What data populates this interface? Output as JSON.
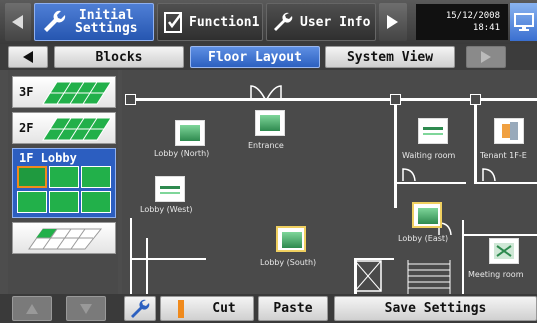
{
  "topbar": {
    "tabs": [
      {
        "label_line1": "Initial",
        "label_line2": "Settings",
        "icon": "wrench-icon"
      },
      {
        "label": "Function1",
        "icon": "checklist-icon"
      },
      {
        "label": "User Info",
        "icon": "wrench-icon"
      }
    ],
    "date": "15/12/2008",
    "time": "18:41"
  },
  "tabs2": {
    "items": [
      "Blocks",
      "Floor Layout",
      "System View"
    ],
    "active": "Floor Layout"
  },
  "floors": [
    {
      "label": "3F"
    },
    {
      "label": "2F"
    },
    {
      "label": "1F Lobby"
    }
  ],
  "map": {
    "rooms": [
      "Lobby (North)",
      "Entrance",
      "Waiting room",
      "Tenant 1F-E",
      "Lobby (West)",
      "Lobby (East)",
      "Lobby (South)",
      "Meeting room"
    ]
  },
  "bottombar": {
    "cut": "Cut",
    "paste": "Paste",
    "save": "Save Settings"
  },
  "colors": {
    "accent_blue": "#2c60c0",
    "unit_green": "#2e8a4f",
    "floor_tile_green": "#22b04a"
  }
}
